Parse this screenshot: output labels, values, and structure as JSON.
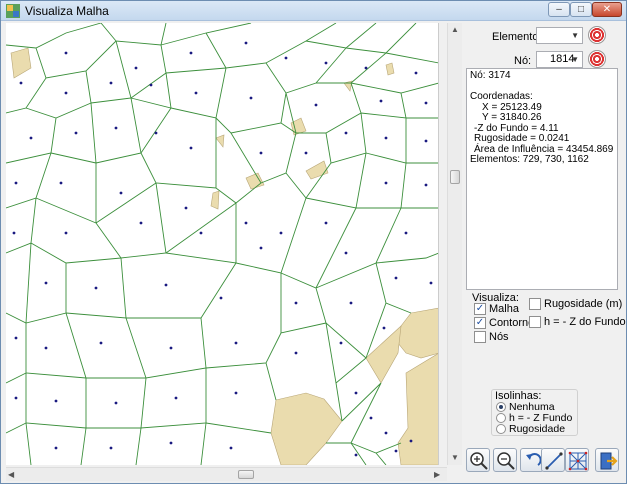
{
  "window": {
    "title": "Visualiza Malha"
  },
  "controls": {
    "elemento_label": "Elemento:",
    "elemento_value": "",
    "no_label": "Nó:",
    "no_value": "1814"
  },
  "info": {
    "no_line": "Nó: 3174",
    "coord_header": "Coordenadas:",
    "x_line": "X = 25123.49",
    "y_line": "Y = 31840.26",
    "z_line": "-Z do Fundo = 4.11",
    "rug_line": "Rugosidade = 0.0241",
    "area_line": "Área de Influência = 43454.869",
    "elementos_line": "Elementos: 729, 730, 1162"
  },
  "visualiza": {
    "title": "Visualiza:",
    "items": [
      {
        "label": "Malha",
        "checked": true
      },
      {
        "label": "Contornos",
        "checked": true
      },
      {
        "label": "Nós",
        "checked": false
      },
      {
        "label": "Rugosidade (m)",
        "checked": false
      },
      {
        "label": "h = - Z do Fundo (m)",
        "checked": false
      }
    ]
  },
  "isolinhas": {
    "title": "Isolinhas:",
    "options": [
      {
        "label": "Nenhuma",
        "selected": true
      },
      {
        "label": "h = - Z Fundo",
        "selected": false
      },
      {
        "label": "Rugosidade",
        "selected": false
      }
    ]
  },
  "toolbar": {
    "icons": [
      "zoom-in-icon",
      "zoom-out-icon",
      "undo-zoom-icon",
      "line-tool-icon",
      "mesh-grid-icon",
      "exit-icon"
    ]
  },
  "colors": {
    "mesh_edge": "#3c8f3c",
    "node": "#1a1a80",
    "land": "#eadcae",
    "title_bar": "#c4d8ee"
  }
}
